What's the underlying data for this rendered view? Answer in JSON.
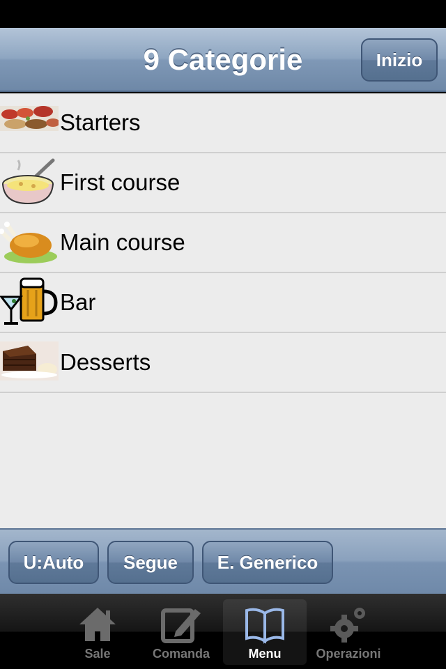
{
  "header": {
    "title": "9 Categorie",
    "home_button": "Inizio"
  },
  "categories": [
    {
      "label": "Starters",
      "icon": "starters-food-icon"
    },
    {
      "label": "First course",
      "icon": "soup-pot-icon"
    },
    {
      "label": "Main course",
      "icon": "roast-chicken-icon"
    },
    {
      "label": "Bar",
      "icon": "cocktail-beer-icon"
    },
    {
      "label": "Desserts",
      "icon": "cake-dessert-icon"
    }
  ],
  "toolbar": {
    "user_button": "U:Auto",
    "next_button": "Segue",
    "generic_button": "E. Generico"
  },
  "tabs": [
    {
      "label": "Sale",
      "icon": "house-icon"
    },
    {
      "label": "Comanda",
      "icon": "edit-note-icon"
    },
    {
      "label": "Menu",
      "icon": "open-book-icon",
      "active": true
    },
    {
      "label": "Operazioni",
      "icon": "gears-icon"
    }
  ],
  "colors": {
    "navbar": "#7f98b6",
    "tab_active": "#9ab8e8",
    "list_bg": "#ececec"
  }
}
